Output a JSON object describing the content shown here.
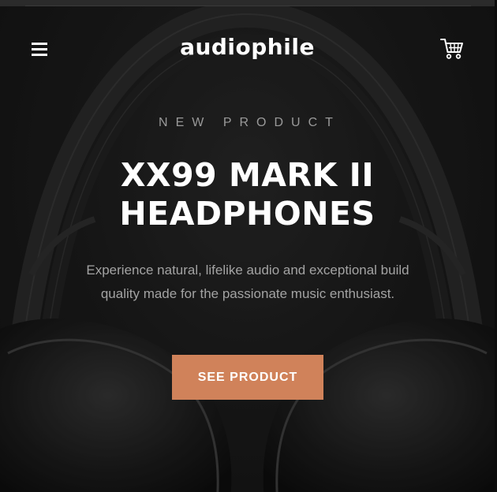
{
  "header": {
    "logo": "audiophile",
    "menu_icon": "hamburger-icon",
    "cart_icon": "cart-icon"
  },
  "hero": {
    "overline": "NEW PRODUCT",
    "title_line1": "XX99 MARK II",
    "title_line2": "HEADPHONES",
    "description": "Experience natural, lifelike audio and exceptional build quality made for the passionate music enthusiast.",
    "cta_label": "SEE PRODUCT"
  },
  "colors": {
    "background": "#1a1a1a",
    "accent": "#d0825a",
    "text_primary": "#ffffff",
    "text_muted": "#a3a3a3"
  }
}
